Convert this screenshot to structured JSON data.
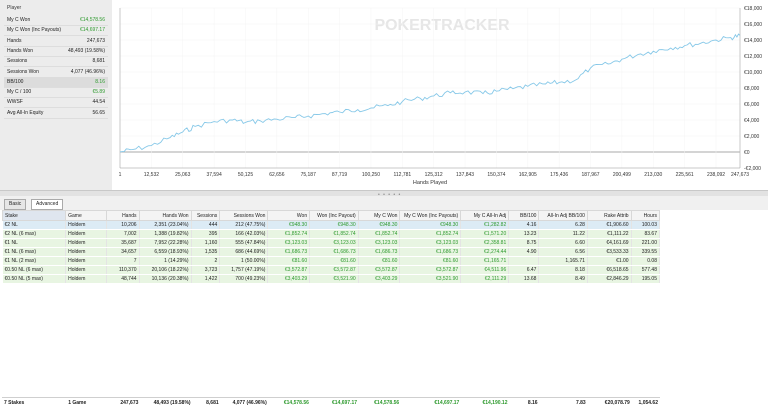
{
  "player_panel": {
    "title": "Player",
    "stats": [
      {
        "label": "My C Won",
        "value": "€14,578.56",
        "green": true
      },
      {
        "label": "My C Won (Inc Payouts)",
        "value": "€14,697.17",
        "green": true
      },
      {
        "label": "Hands",
        "value": "247,673",
        "green": false
      },
      {
        "label": "Hands Won",
        "value": "48,493 (19.58%)",
        "green": false
      },
      {
        "label": "Sessions",
        "value": "8,681",
        "green": false
      },
      {
        "label": "Sessions Won",
        "value": "4,077 (46.96%)",
        "green": false
      },
      {
        "label": "BB/100",
        "value": "8.16",
        "green": true
      },
      {
        "label": "My C / 100",
        "value": "€5.89",
        "green": true
      },
      {
        "label": "WWSF",
        "value": "44.54",
        "green": false
      },
      {
        "label": "Avg All-In Equity",
        "value": "56.65",
        "green": false
      }
    ]
  },
  "chart_data": {
    "type": "line",
    "xlabel": "Hands Played",
    "ylabel": "",
    "watermark": "POKERTRACKER",
    "x_ticks": [
      "1",
      "12,532",
      "25,063",
      "37,594",
      "50,125",
      "62,656",
      "75,187",
      "87,719",
      "100,250",
      "112,781",
      "125,312",
      "137,843",
      "150,374",
      "162,905",
      "175,436",
      "187,967",
      "200,499",
      "213,030",
      "225,561",
      "238,092",
      "247,673"
    ],
    "y_ticks": [
      "€18,000",
      "€16,000",
      "€14,000",
      "€12,000",
      "€10,000",
      "€8,000",
      "€6,000",
      "€4,000",
      "€2,000",
      "€0",
      "-€2,000"
    ],
    "ylim": [
      -2000,
      18000
    ],
    "xlim": [
      1,
      247673
    ],
    "series": [
      {
        "color": "#86c8e8",
        "x": [
          1,
          5000,
          12532,
          20000,
          25063,
          30000,
          37594,
          45000,
          50125,
          56000,
          62656,
          70000,
          75187,
          82000,
          87719,
          95000,
          100250,
          107000,
          112781,
          120000,
          125312,
          132000,
          137843,
          145000,
          150374,
          157000,
          162905,
          170000,
          175436,
          182000,
          187967,
          195000,
          200499,
          207000,
          213030,
          220000,
          225561,
          232000,
          238092,
          244000,
          247673
        ],
        "y": [
          0,
          300,
          800,
          1800,
          2500,
          3200,
          3800,
          4000,
          3700,
          3900,
          4100,
          4300,
          4500,
          4800,
          5000,
          5300,
          5500,
          5800,
          6300,
          6700,
          7000,
          7400,
          7500,
          7300,
          7600,
          7900,
          8200,
          8500,
          8700,
          9000,
          10500,
          11000,
          11600,
          12200,
          12600,
          13000,
          13300,
          13600,
          14000,
          14300,
          14578.56
        ]
      }
    ]
  },
  "tabs": [
    {
      "label": "Basic",
      "active": false
    },
    {
      "label": "Advanced",
      "active": true
    }
  ],
  "table": {
    "headers": [
      "Stake",
      "Game",
      "Hands",
      "Hands Won",
      "Sessions",
      "Sessions Won",
      "Won",
      "Won (Inc Payout)",
      "My C Won",
      "My C Won (Inc Payouts)",
      "My C All-In Adj",
      "BB/100",
      "All-In Adj BB/100",
      "Rake Attrib",
      "Hours"
    ],
    "rows": [
      [
        "€2 NL",
        "Holdem",
        "10,206",
        "2,351 (23.04%)",
        "444",
        "212 (47.75%)",
        "€948.30",
        "€948.30",
        "€948.30",
        "€948.30",
        "€1,282.82",
        "4.16",
        "6.28",
        "€1,906.60",
        "100.03"
      ],
      [
        "€2 NL (6 max)",
        "Holdem",
        "7,002",
        "1,388 (19.82%)",
        "395",
        "166 (42.03%)",
        "€1,852.74",
        "€1,852.74",
        "€1,852.74",
        "€1,852.74",
        "€1,571.20",
        "13.23",
        "11.22",
        "€1,111.22",
        "83.67"
      ],
      [
        "€1 NL",
        "Holdem",
        "35,687",
        "7,952 (22.28%)",
        "1,160",
        "555 (47.84%)",
        "€3,123.03",
        "€3,123.03",
        "€3,123.03",
        "€3,123.03",
        "€2,358.81",
        "8.75",
        "6.60",
        "€4,161.69",
        "221.00"
      ],
      [
        "€1 NL (6 max)",
        "Holdem",
        "34,657",
        "6,559 (18.93%)",
        "1,535",
        "686 (44.69%)",
        "€1,686.73",
        "€1,686.73",
        "€1,686.73",
        "€1,686.73",
        "€2,274.44",
        "4.90",
        "6.56",
        "€3,533.33",
        "339.55"
      ],
      [
        "€1 NL (2 max)",
        "Holdem",
        "7",
        "1 (14.29%)",
        "2",
        "1 (50.00%)",
        "€81.60",
        "€81.60",
        "€81.60",
        "€81.60",
        "€1,165.71",
        "",
        "1,165.71",
        "€1.00",
        "0.08"
      ],
      [
        "€0.50 NL (6 max)",
        "Holdem",
        "110,370",
        "20,106 (18.22%)",
        "3,723",
        "1,757 (47.19%)",
        "€3,572.87",
        "€3,572.87",
        "€3,572.87",
        "€3,572.87",
        "€4,511.96",
        "6.47",
        "8.18",
        "€6,518.65",
        "577.48"
      ],
      [
        "€0.50 NL (5 max)",
        "Holdem",
        "48,744",
        "10,136 (20.38%)",
        "1,422",
        "700 (49.23%)",
        "€3,403.29",
        "€3,521.90",
        "€3,403.29",
        "€3,521.90",
        "€2,111.29",
        "13.68",
        "8.49",
        "€2,846.29",
        "195.05"
      ]
    ],
    "totals": [
      "7 Stakes",
      "1 Game",
      "247,673",
      "48,493 (19.58%)",
      "8,681",
      "4,077 (46.96%)",
      "€14,578.56",
      "€14,697.17",
      "€14,578.56",
      "€14,697.17",
      "€14,190.12",
      "8.16",
      "7.83",
      "€20,078.79",
      "1,054.62"
    ]
  }
}
